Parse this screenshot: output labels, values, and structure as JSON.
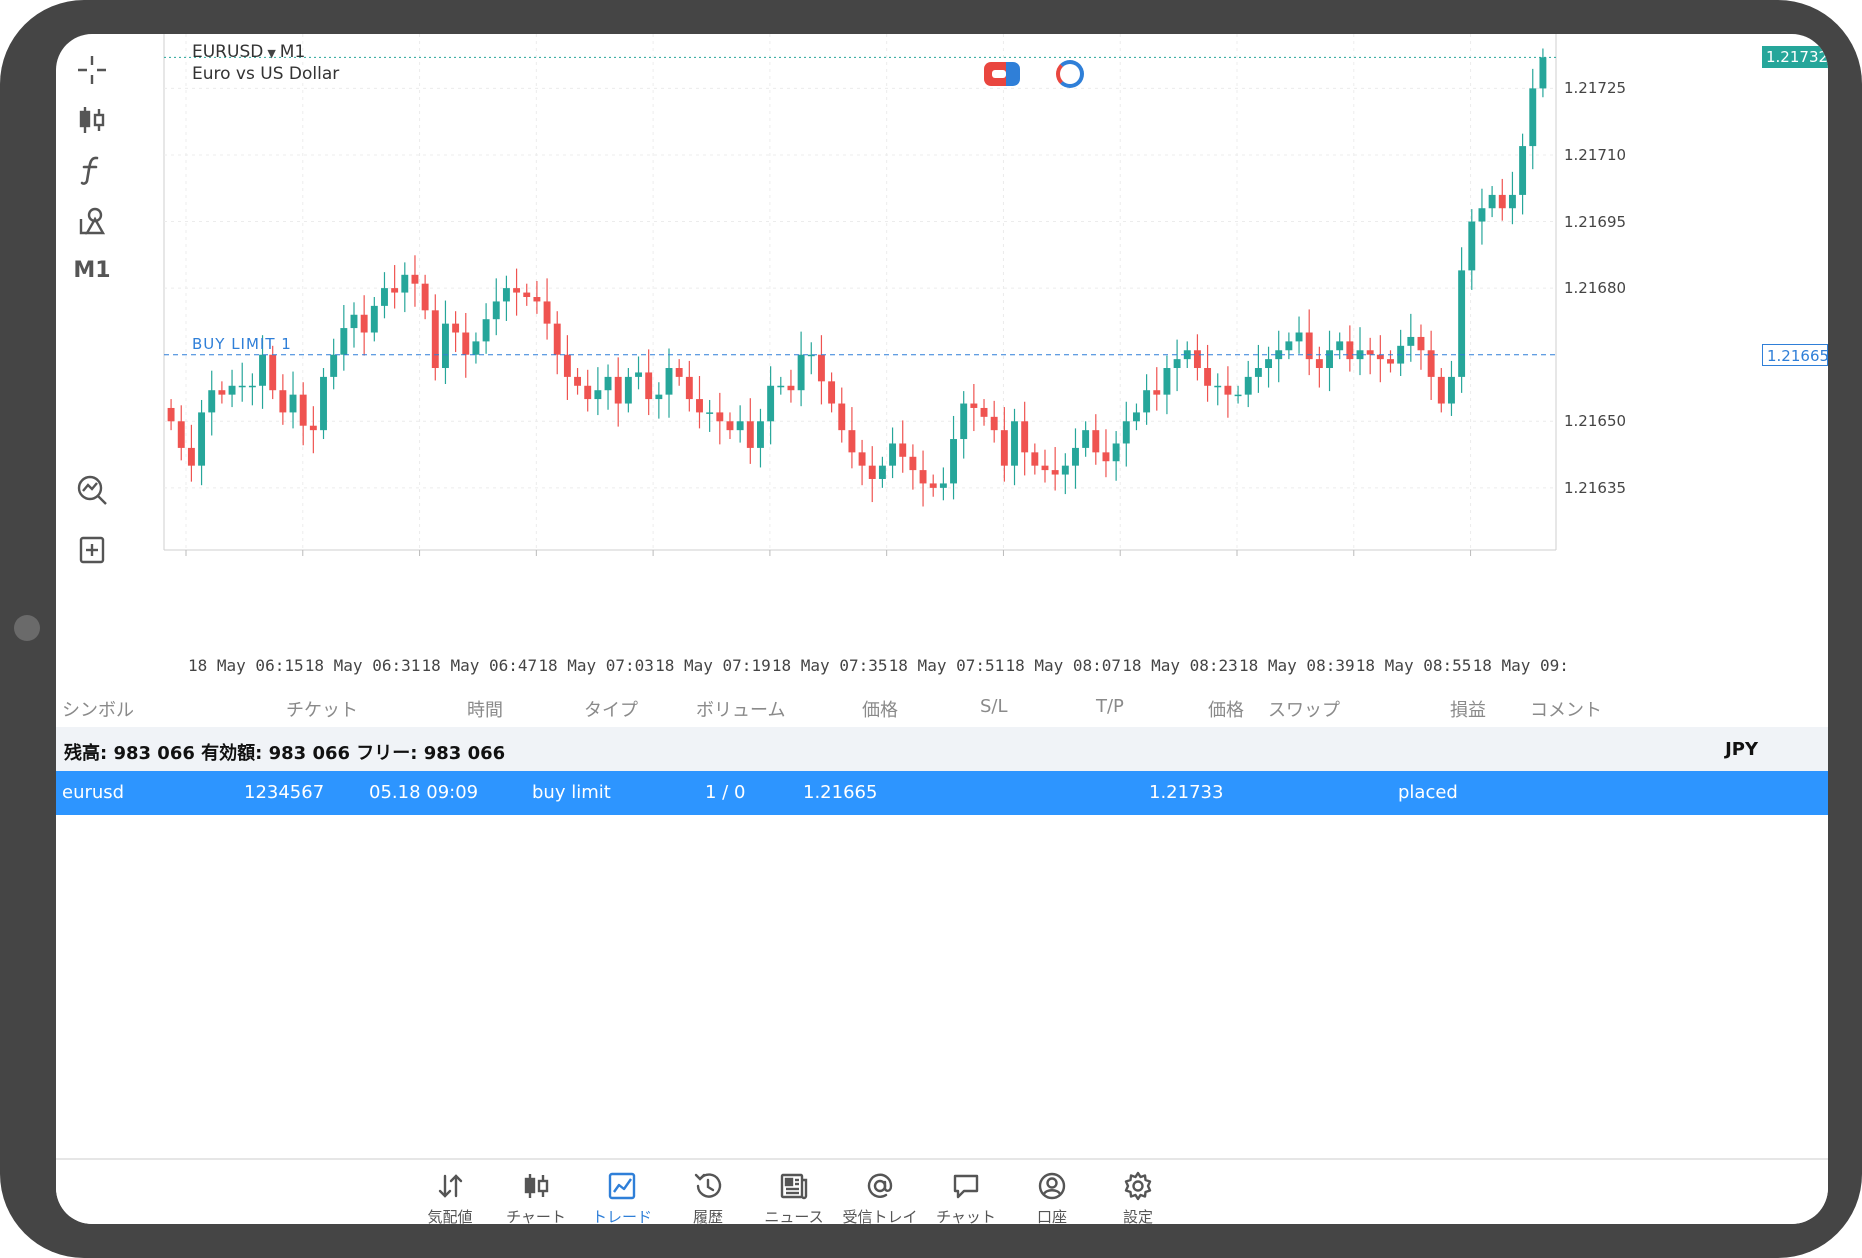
{
  "toolbar": {
    "items": [
      {
        "name": "crosshair-icon"
      },
      {
        "name": "candlestick-icon"
      },
      {
        "name": "function-icon"
      },
      {
        "name": "objects-icon"
      },
      {
        "name": "timeframe",
        "label": "M1"
      },
      {
        "name": "indicator-search-icon"
      },
      {
        "name": "add-chart-icon"
      }
    ]
  },
  "chart": {
    "symbol": "EURUSD",
    "timeframe": "M1",
    "description": "Euro vs US Dollar",
    "buy_limit_label": "BUY LIMIT 1",
    "current_price": "1.21732",
    "limit_price": "1.21665",
    "colors": {
      "up": "#26a69a",
      "down": "#ef5350",
      "limit_line": "#2f7fd8",
      "price_line": "#26a69a"
    }
  },
  "chart_data": {
    "type": "candlestick",
    "symbol": "EURUSD",
    "y_ticks": [
      "1.21725",
      "1.21710",
      "1.21695",
      "1.21680",
      "1.21650",
      "1.21635"
    ],
    "ylim": [
      1.21621,
      1.21735
    ],
    "x_ticks": [
      "18 May 06:15",
      "18 May 06:31",
      "18 May 06:47",
      "18 May 07:03",
      "18 May 07:19",
      "18 May 07:35",
      "18 May 07:51",
      "18 May 08:07",
      "18 May 08:23",
      "18 May 08:39",
      "18 May 08:55",
      "18 May 09:"
    ],
    "buy_limit": 1.21665,
    "last": 1.21732,
    "closes": [
      1.2165,
      1.21644,
      1.2164,
      1.21652,
      1.21657,
      1.21656,
      1.21658,
      1.21658,
      1.21658,
      1.21665,
      1.21657,
      1.21652,
      1.21656,
      1.21649,
      1.21648,
      1.2166,
      1.21665,
      1.21671,
      1.21674,
      1.2167,
      1.21676,
      1.2168,
      1.21679,
      1.21683,
      1.21681,
      1.21675,
      1.21662,
      1.21672,
      1.2167,
      1.21665,
      1.21668,
      1.21673,
      1.21677,
      1.2168,
      1.21679,
      1.21678,
      1.21677,
      1.21672,
      1.21665,
      1.2166,
      1.21658,
      1.21655,
      1.21657,
      1.2166,
      1.21654,
      1.2166,
      1.21661,
      1.21655,
      1.21656,
      1.21662,
      1.2166,
      1.21655,
      1.21652,
      1.21652,
      1.2165,
      1.21648,
      1.2165,
      1.21644,
      1.2165,
      1.21658,
      1.21658,
      1.21657,
      1.21665,
      1.21665,
      1.21659,
      1.21654,
      1.21648,
      1.21643,
      1.2164,
      1.21637,
      1.2164,
      1.21645,
      1.21642,
      1.21639,
      1.21636,
      1.21635,
      1.21636,
      1.21646,
      1.21654,
      1.21653,
      1.21651,
      1.21648,
      1.2164,
      1.2165,
      1.21643,
      1.2164,
      1.21639,
      1.21638,
      1.2164,
      1.21644,
      1.21648,
      1.21643,
      1.21641,
      1.21645,
      1.2165,
      1.21652,
      1.21657,
      1.21656,
      1.21662,
      1.21664,
      1.21666,
      1.21662,
      1.21658,
      1.21658,
      1.21656,
      1.21656,
      1.2166,
      1.21662,
      1.21664,
      1.21666,
      1.21668,
      1.2167,
      1.21664,
      1.21662,
      1.21666,
      1.21668,
      1.21664,
      1.21666,
      1.21665,
      1.21664,
      1.21663,
      1.21667,
      1.21669,
      1.21666,
      1.2166,
      1.21654,
      1.2166,
      1.21684,
      1.21695,
      1.21698,
      1.21701,
      1.21698,
      1.21701,
      1.21712,
      1.21725,
      1.21732
    ]
  },
  "table": {
    "headers": [
      "シンボル",
      "チケット",
      "時間",
      "タイプ",
      "ボリューム",
      "価格",
      "S/L",
      "T/P",
      "価格",
      "スワップ",
      "損益",
      "コメント"
    ],
    "balance": "残高: 983 066 有効額: 983 066 フリー: 983 066",
    "currency": "JPY",
    "orders": [
      {
        "symbol": "eurusd",
        "ticket": "1234567",
        "time": "05.18 09:09",
        "type": "buy limit",
        "volume": "1 / 0",
        "price": "1.21665",
        "current_price": "1.21733",
        "status": "placed"
      }
    ]
  },
  "nav": {
    "items": [
      {
        "label": "気配値",
        "icon": "quotes-icon"
      },
      {
        "label": "チャート",
        "icon": "chart-icon"
      },
      {
        "label": "トレード",
        "icon": "trade-icon",
        "active": true
      },
      {
        "label": "履歴",
        "icon": "history-icon"
      },
      {
        "label": "ニュース",
        "icon": "news-icon"
      },
      {
        "label": "受信トレイ",
        "icon": "inbox-icon"
      },
      {
        "label": "チャット",
        "icon": "chat-icon"
      },
      {
        "label": "口座",
        "icon": "account-icon"
      },
      {
        "label": "設定",
        "icon": "settings-icon"
      }
    ],
    "active_color": "#2f7fd8"
  }
}
